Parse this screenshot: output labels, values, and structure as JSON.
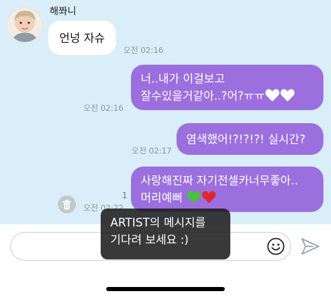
{
  "sender": {
    "name": "해쫘니"
  },
  "messages": [
    {
      "text": "언넝 자슈",
      "time": "오전 02:16"
    },
    {
      "text": "너..내가 이걸보고\n잘수있을거같아..?어?ㅠㅠ",
      "time": "오전 02:16"
    },
    {
      "text": "염색했어!?!?!?! 실시간?",
      "time": "오전 02:17"
    },
    {
      "text": "사랑해진짜 자기전셀카너무좋아..\n머리예뻐",
      "time": "오전 02:22",
      "unread": "1"
    }
  ],
  "toast": {
    "text": "ARTIST의 메시지를\n기다려 보세요 :)"
  },
  "input": {
    "placeholder": "",
    "value": ""
  },
  "icons": {
    "heart_white": "white-heart-icon",
    "heart_green": "green-heart-icon",
    "heart_red": "red-heart-icon",
    "trash": "trash-icon",
    "emoji": "smiley-icon",
    "send": "send-icon"
  },
  "colors": {
    "chat_bg": "#d9eef8",
    "outgoing_bubble": "#9b6fde",
    "incoming_bubble": "#ffffff",
    "heart_green": "#47c23a",
    "heart_red": "#e0262b"
  }
}
